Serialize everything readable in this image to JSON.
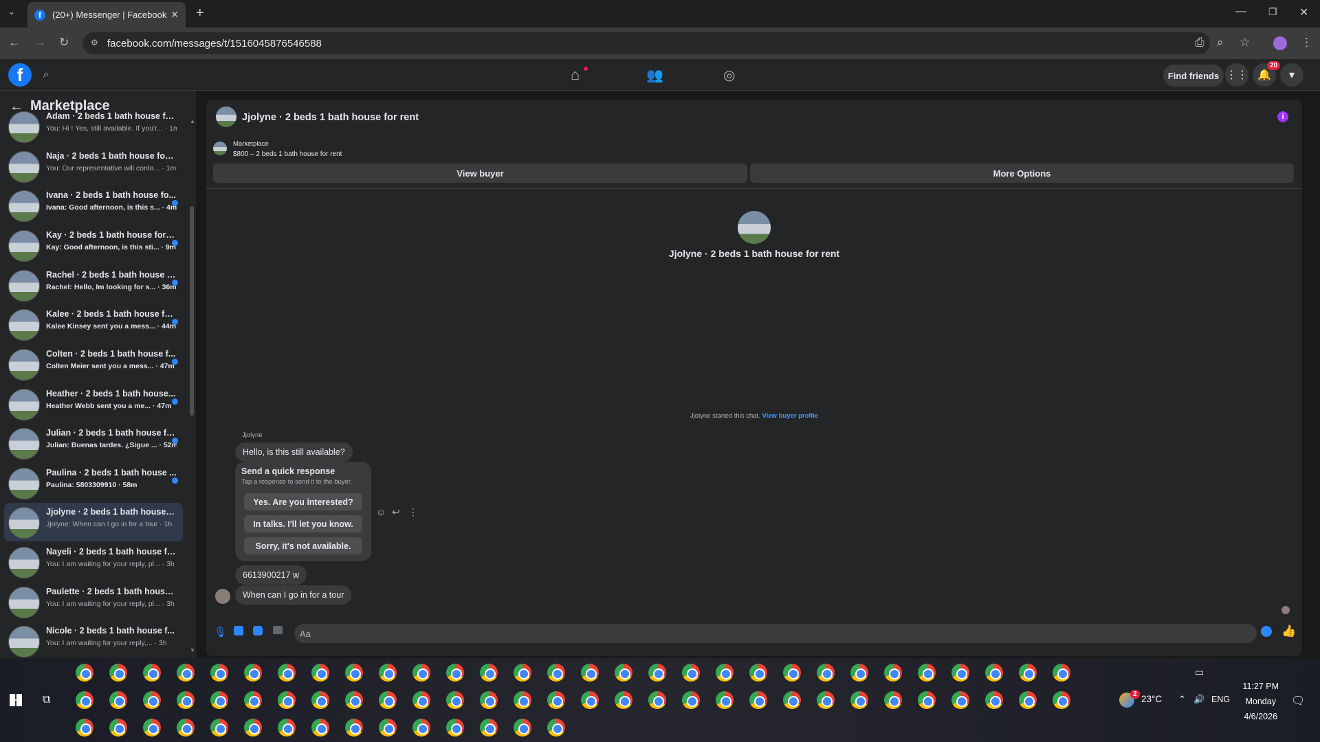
{
  "browser": {
    "tab_title": "(20+) Messenger | Facebook",
    "url": "facebook.com/messages/t/1516045876546588"
  },
  "header": {
    "find_friends": "Find friends",
    "notification_count": "20"
  },
  "sidebar": {
    "title": "Marketplace",
    "conversations": [
      {
        "title": "Adam · 2 beds 1 bath house for ...",
        "preview": "You: Hi ! Yes, still available. If you'r... · 1m",
        "unread": false
      },
      {
        "title": "Naja · 2 beds 1 bath house for r...",
        "preview": "You: Our representative will conta... · 1m",
        "unread": false
      },
      {
        "title": "Ivana · 2 beds 1 bath house fo...",
        "preview": "Ivana: Good afternoon, is this s... · 4m",
        "unread": true
      },
      {
        "title": "Kay · 2 beds 1 bath house for r...",
        "preview": "Kay: Good afternoon, is this sti... · 9m",
        "unread": true
      },
      {
        "title": "Rachel · 2 beds 1 bath house f...",
        "preview": "Rachel: Hello, Im looking for s... · 36m",
        "unread": true
      },
      {
        "title": "Kalee · 2 beds 1 bath house fo...",
        "preview": "Kalee Kinsey sent you a mess... · 44m",
        "unread": true
      },
      {
        "title": "Colten · 2 beds 1 bath house f...",
        "preview": "Colten Meier sent you a mess... · 47m",
        "unread": true
      },
      {
        "title": "Heather · 2 beds 1 bath house...",
        "preview": "Heather Webb sent you a me... · 47m",
        "unread": true
      },
      {
        "title": "Julian · 2 beds 1 bath house fo...",
        "preview": "Julian: Buenas tardes. ¿Sigue ... · 52m",
        "unread": true
      },
      {
        "title": "Paulina · 2 beds 1 bath house ...",
        "preview": "Paulina: 5803309910 · 58m",
        "unread": true
      },
      {
        "title": "Jjolyne · 2 beds 1 bath house fo...",
        "preview": "Jjolyne: When can I go in for a tour · 1h",
        "unread": false
      },
      {
        "title": "Nayeli · 2 beds 1 bath house for...",
        "preview": "You: I am waiting for your reply, pl... · 3h",
        "unread": false
      },
      {
        "title": "Paulette · 2 beds 1 bath house f...",
        "preview": "You: I am waiting for your reply, pl... · 3h",
        "unread": false
      },
      {
        "title": "Nicole · 2 beds 1 bath house f...",
        "preview": "You: I am waiting for your reply,... · 3h",
        "unread": false
      }
    ]
  },
  "chat": {
    "title": "Jjolyne · 2 beds 1 bath house for rent",
    "listing_source": "Marketplace",
    "listing_price": "$800 – 2 beds 1 bath house for rent",
    "view_buyer": "View buyer",
    "more_options": "More Options",
    "center_title": "Jjolyne · 2 beds 1 bath house for rent",
    "started_text": "Jjolyne started this chat.",
    "view_buyer_profile": "View buyer profile",
    "sender_name": "Jjolyne",
    "msg1": "Hello, is this still available?",
    "quick_title": "Send a quick response",
    "quick_sub": "Tap a response to send it to the buyer.",
    "quick1": "Yes. Are you interested?",
    "quick2": "In talks. I'll let you know.",
    "quick3": "Sorry, it's not available.",
    "msg2": "6613900217 w",
    "msg3": "When can I go in for a tour",
    "input_placeholder": "Aa"
  },
  "system": {
    "weather": "23°C",
    "weather_badge": "2",
    "lang": "ENG",
    "time": "11:27 PM",
    "day": "Monday",
    "date": "4/6/2026"
  },
  "colors": {
    "accent": "#1877f2",
    "unread_dot": "#2d88ff",
    "info_icon": "#a033ff"
  }
}
